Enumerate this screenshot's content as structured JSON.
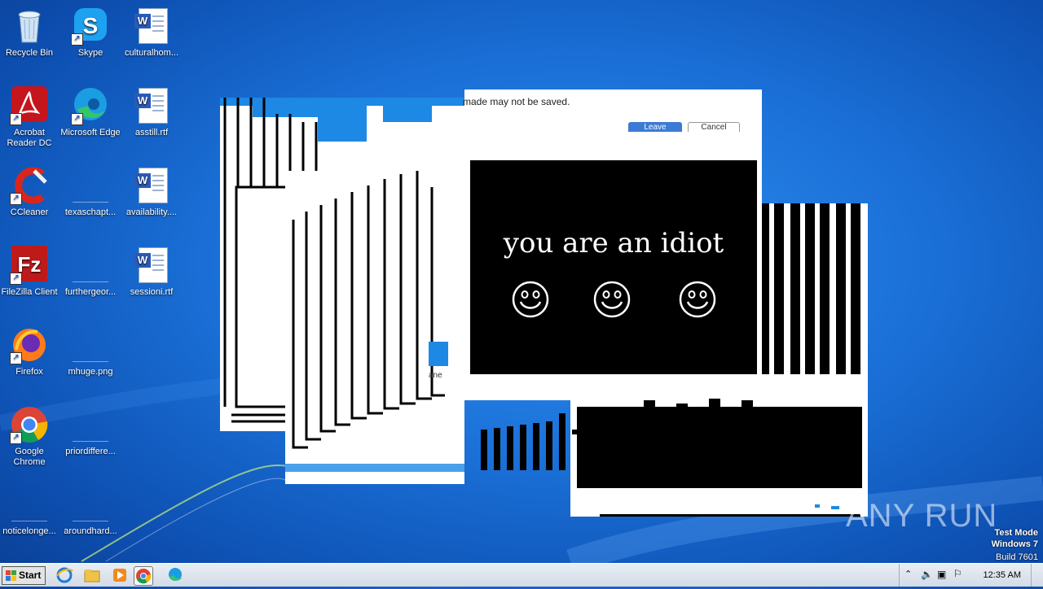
{
  "desktop": {
    "icons": [
      {
        "label": "Recycle Bin",
        "icon": "recycle-bin-icon"
      },
      {
        "label": "Skype",
        "icon": "skype-icon"
      },
      {
        "label": "culturalhom...",
        "icon": "word-doc-icon"
      },
      {
        "label": "Acrobat Reader DC",
        "icon": "acrobat-icon"
      },
      {
        "label": "Microsoft Edge",
        "icon": "edge-icon"
      },
      {
        "label": "asstill.rtf",
        "icon": "word-doc-icon"
      },
      {
        "label": "CCleaner",
        "icon": "ccleaner-icon"
      },
      {
        "label": "texaschapt...",
        "icon": "blank-file-icon"
      },
      {
        "label": "availability....",
        "icon": "word-doc-icon"
      },
      {
        "label": "FileZilla Client",
        "icon": "filezilla-icon"
      },
      {
        "label": "furthergeor...",
        "icon": "blank-file-icon"
      },
      {
        "label": "sessioni.rtf",
        "icon": "word-doc-icon"
      },
      {
        "label": "Firefox",
        "icon": "firefox-icon"
      },
      {
        "label": "mhuge.png",
        "icon": "blank-file-icon"
      },
      {
        "label": "Google Chrome",
        "icon": "chrome-icon"
      },
      {
        "label": "priordiffere...",
        "icon": "blank-file-icon"
      },
      {
        "label": "noticelonge...",
        "icon": "blank-file-icon"
      },
      {
        "label": "aroundhard...",
        "icon": "blank-file-icon"
      }
    ]
  },
  "popup": {
    "headline": "you are an idiot",
    "smileys": [
      "smiley-icon",
      "smiley-icon",
      "smiley-icon"
    ],
    "dialog_message": "made may not be saved.",
    "leave_label": "Leave",
    "cancel_label": "Cancel",
    "fragment_text": "ane"
  },
  "taskbar": {
    "start_label": "Start",
    "pinned": [
      "internet-explorer-icon",
      "file-explorer-icon",
      "media-player-icon",
      "chrome-icon",
      "edge-icon"
    ],
    "tray_icons": [
      "chevron-up-icon",
      "volume-icon",
      "network-icon",
      "flag-icon"
    ],
    "clock": "12:35 AM"
  },
  "watermark": {
    "line1": "Test Mode",
    "line2": "Windows 7",
    "line3": "Build 7601",
    "brand": "ANY RUN"
  },
  "colors": {
    "desktop_blue": "#1a6fd6",
    "taskbar": "#dfe5ee",
    "popup_black": "#000000"
  }
}
